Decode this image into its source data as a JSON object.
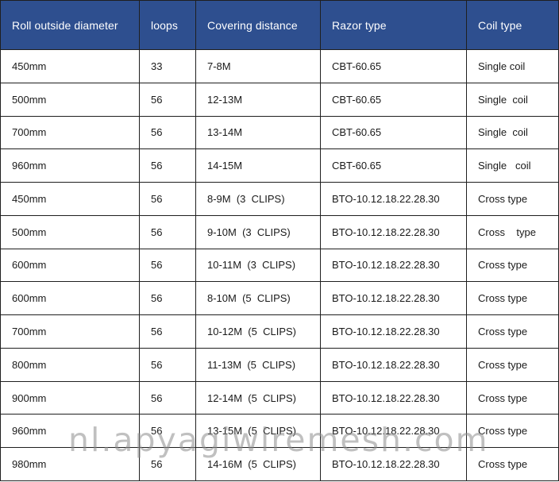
{
  "table": {
    "headers": [
      "Roll outside diameter",
      "loops",
      "Covering distance",
      "Razor  type",
      "Coil type"
    ],
    "rows": [
      [
        "450mm",
        "33",
        "7-8M",
        "CBT-60.65",
        "Single coil"
      ],
      [
        "500mm",
        "56",
        "12-13M",
        "CBT-60.65",
        "Single  coil"
      ],
      [
        "700mm",
        "56",
        "13-14M",
        "CBT-60.65",
        "Single  coil"
      ],
      [
        "960mm",
        "56",
        "14-15M",
        "CBT-60.65",
        "Single   coil"
      ],
      [
        "450mm",
        "56",
        "8-9M  (3  CLIPS)",
        "BTO-10.12.18.22.28.30",
        "Cross type"
      ],
      [
        "500mm",
        "56",
        "9-10M  (3  CLIPS)",
        "BTO-10.12.18.22.28.30",
        "Cross    type"
      ],
      [
        "600mm",
        "56",
        "10-11M  (3  CLIPS)",
        "BTO-10.12.18.22.28.30",
        "Cross type"
      ],
      [
        "600mm",
        "56",
        "8-10M  (5  CLIPS)",
        "BTO-10.12.18.22.28.30",
        "Cross type"
      ],
      [
        "700mm",
        "56",
        "10-12M  (5  CLIPS)",
        "BTO-10.12.18.22.28.30",
        "Cross type"
      ],
      [
        "800mm",
        "56",
        "11-13M  (5  CLIPS)",
        "BTO-10.12.18.22.28.30",
        "Cross type"
      ],
      [
        "900mm",
        "56",
        "12-14M  (5  CLIPS)",
        "BTO-10.12.18.22.28.30",
        "Cross type"
      ],
      [
        "960mm",
        "56",
        "13-15M  (5  CLIPS)",
        "BTO-10.12.18.22.28.30",
        "Cross type"
      ],
      [
        "980mm",
        "56",
        "14-16M  (5  CLIPS)",
        "BTO-10.12.18.22.28.30",
        "Cross type"
      ]
    ]
  },
  "watermark": "nl.apyagiwiremesh.com",
  "colors": {
    "header_bg": "#2e4f8f",
    "header_text": "#ffffff",
    "border": "#1f1f1f"
  }
}
